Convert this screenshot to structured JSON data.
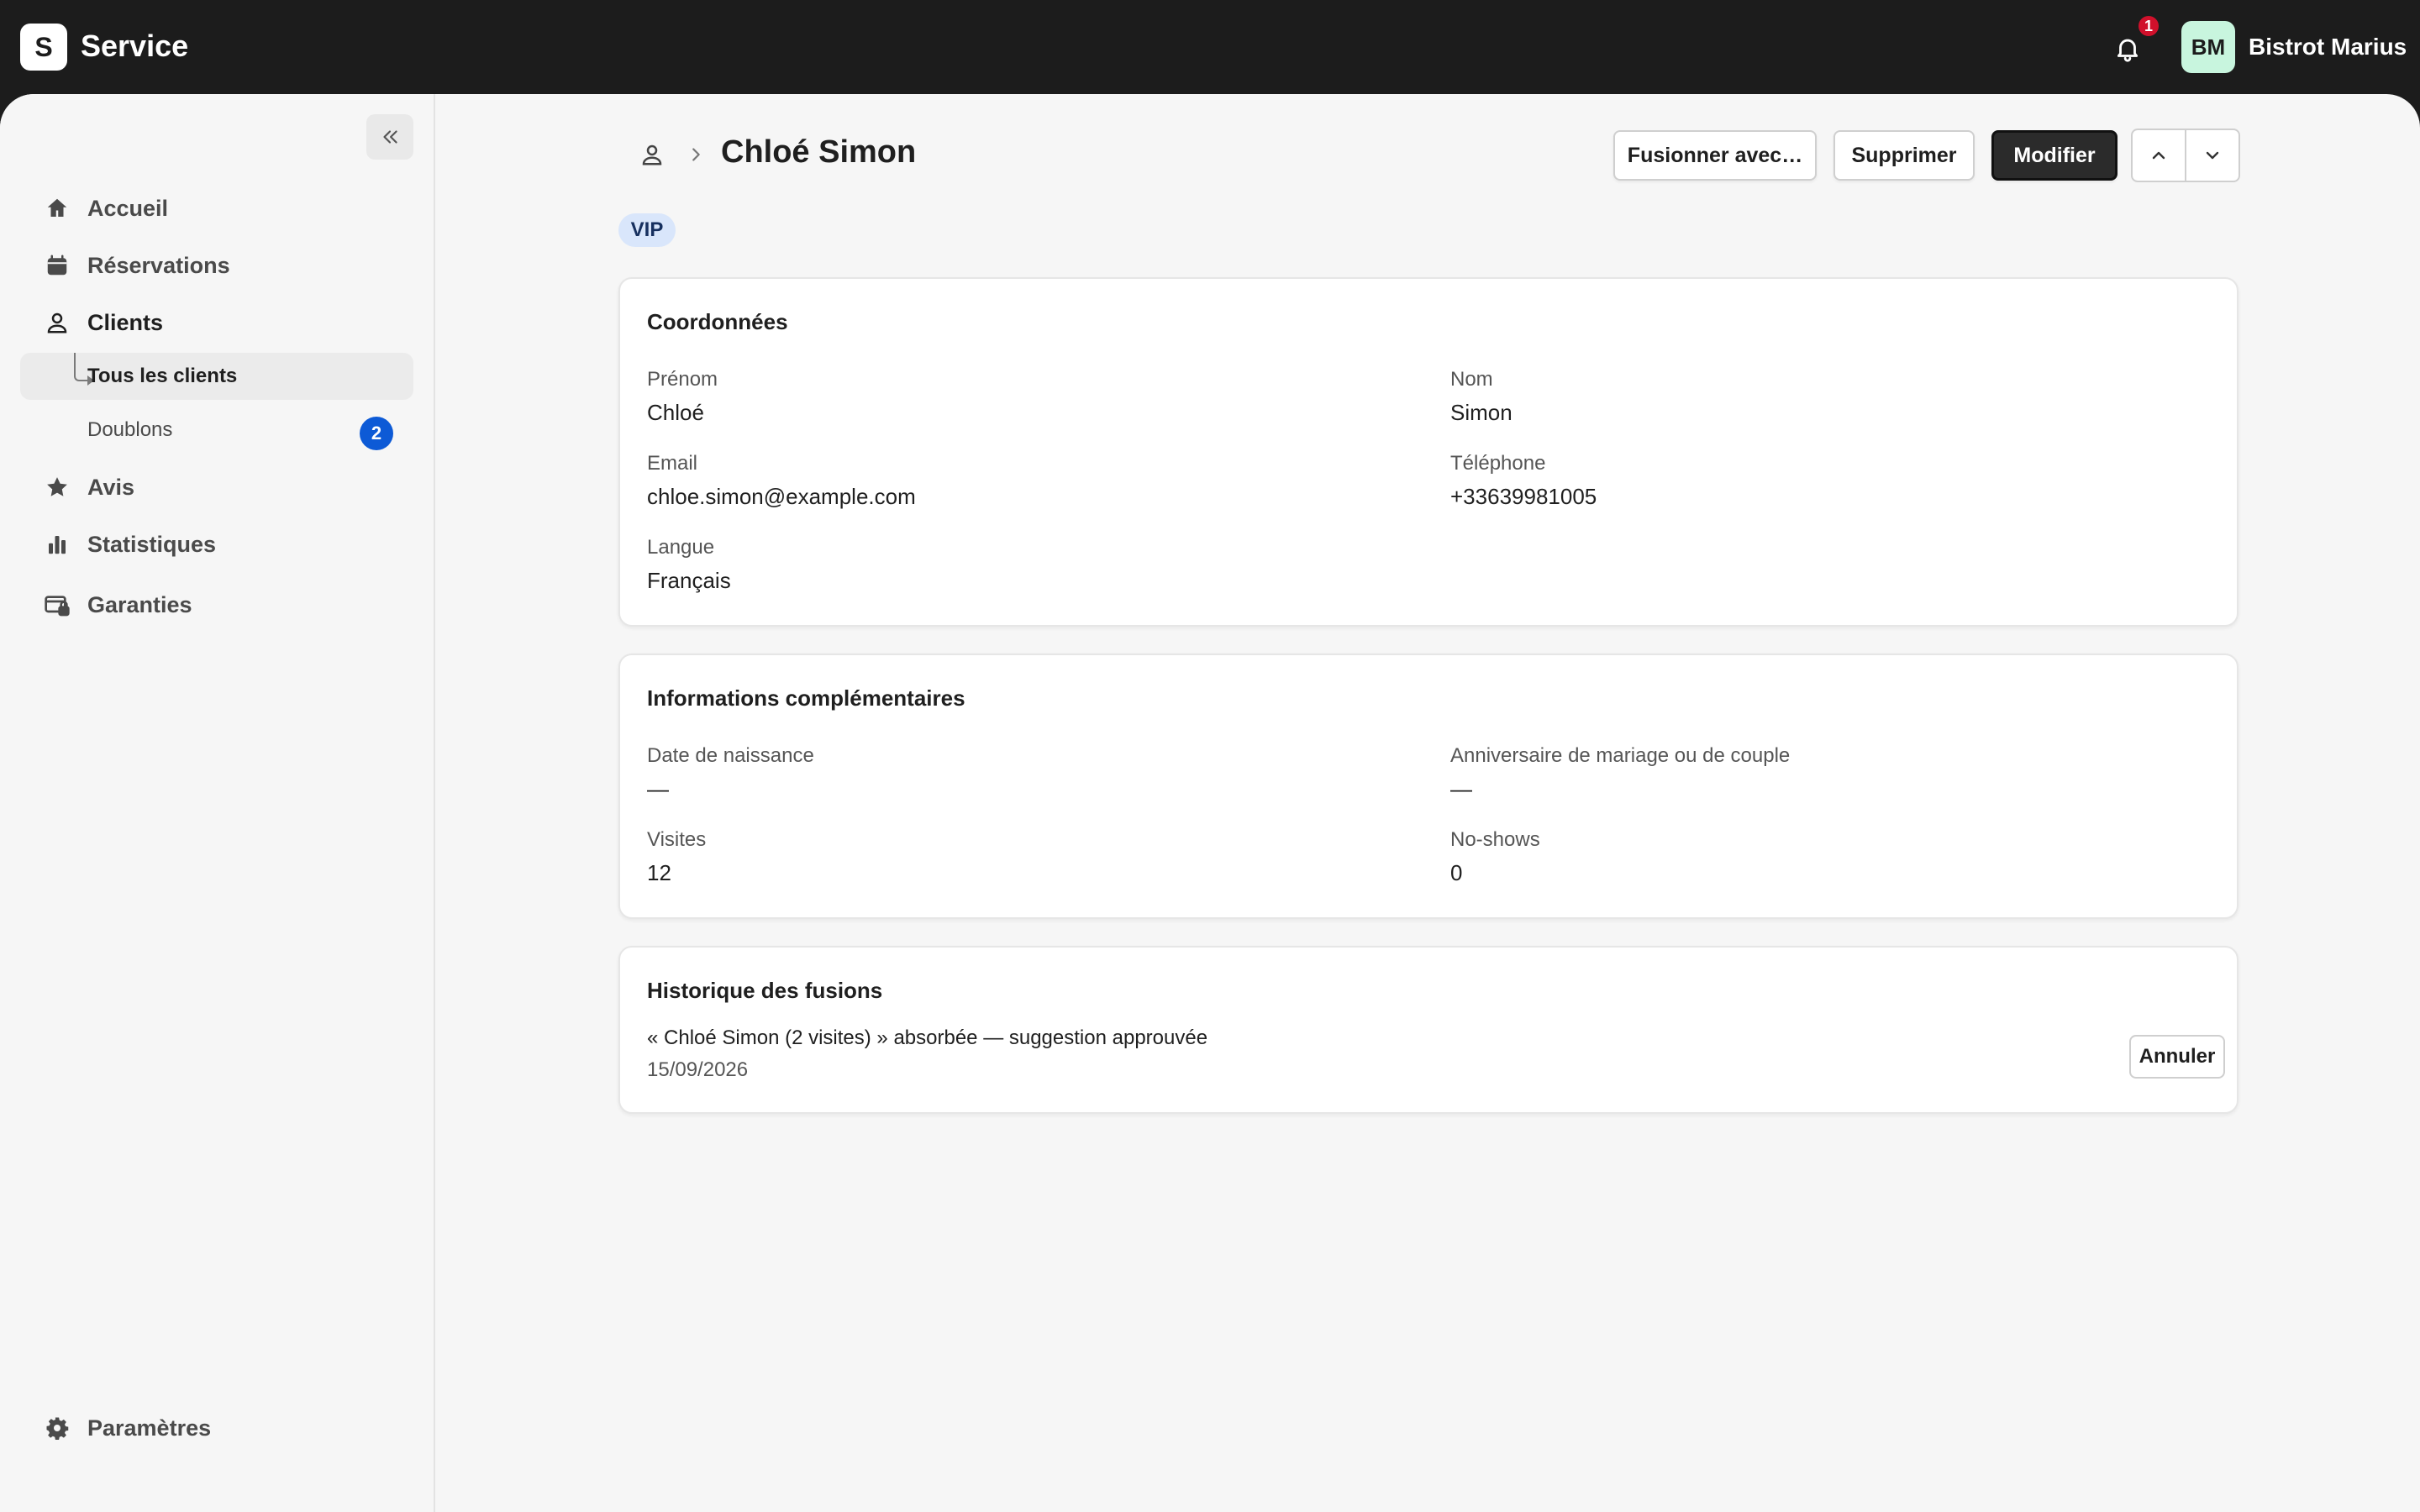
{
  "app": {
    "logo_letter": "S",
    "title": "Service"
  },
  "header": {
    "notification_count": "1",
    "avatar_initials": "BM",
    "user_name": "Bistrot Marius"
  },
  "sidebar": {
    "items": [
      {
        "label": "Accueil",
        "icon": "home-icon"
      },
      {
        "label": "Réservations",
        "icon": "calendar-icon"
      },
      {
        "label": "Clients",
        "icon": "person-icon"
      },
      {
        "label": "Avis",
        "icon": "star-icon"
      },
      {
        "label": "Statistiques",
        "icon": "bar-chart-icon"
      },
      {
        "label": "Garanties",
        "icon": "card-lock-icon"
      }
    ],
    "sub_items": [
      {
        "label": "Tous les clients"
      },
      {
        "label": "Doublons",
        "badge": "2"
      }
    ],
    "footer": {
      "label": "Paramètres",
      "icon": "gear-icon"
    }
  },
  "page": {
    "title": "Chloé Simon",
    "tag": "VIP",
    "actions": {
      "merge": "Fusionner avec…",
      "delete": "Supprimer",
      "edit": "Modifier"
    }
  },
  "contact_card": {
    "title": "Coordonnées",
    "first_name_label": "Prénom",
    "first_name": "Chloé",
    "last_name_label": "Nom",
    "last_name": "Simon",
    "email_label": "Email",
    "email": "chloe.simon@example.com",
    "phone_label": "Téléphone",
    "phone": "+33639981005",
    "language_label": "Langue",
    "language": "Français"
  },
  "info_card": {
    "title": "Informations complémentaires",
    "birthday_label": "Date de naissance",
    "birthday": "—",
    "anniversary_label": "Anniversaire de mariage ou de couple",
    "anniversary": "—",
    "visits_label": "Visites",
    "visits": "12",
    "noshows_label": "No-shows",
    "noshows": "0"
  },
  "history_card": {
    "title": "Historique des fusions",
    "entry_text": "« Chloé Simon (2 visites) » absorbée — suggestion approuvée",
    "entry_date": "15/09/2026",
    "undo_label": "Annuler"
  },
  "colors": {
    "accent_badge": "#0d5ad6",
    "notification": "#d0102b",
    "avatar_bg": "#c8f5de",
    "tag_bg": "#d9e6fb"
  }
}
